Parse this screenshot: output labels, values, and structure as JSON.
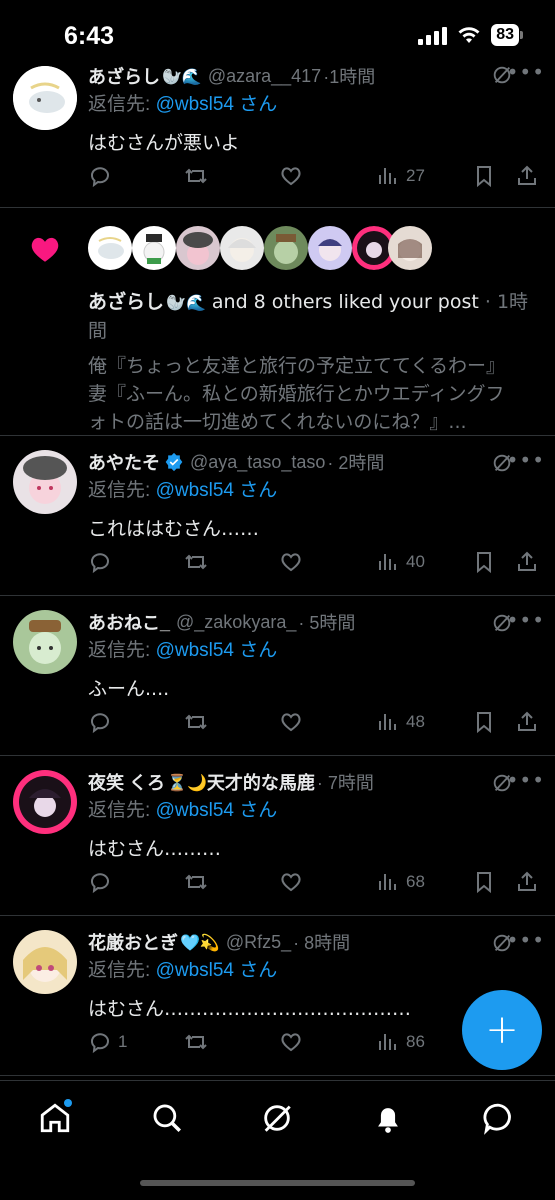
{
  "status": {
    "time": "6:43",
    "battery": "83"
  },
  "replies": [
    {
      "name": "あざらし",
      "emojis": "🦭🌊",
      "handle": "@azara__417",
      "time": "·1時間",
      "reply_prefix": "返信先: ",
      "mention": "@wbsl54 さん",
      "text": "はむさんが悪いよ",
      "replies": "",
      "views": "27"
    }
  ],
  "liked": {
    "name": "あざらし",
    "emojis": "🦭🌊",
    "suffix": " and 8 others liked your post",
    "time": "· 1時間",
    "preview_line1": "俺『ちょっと友達と旅行の予定立ててくるわー』",
    "preview_line2": "妻『ふーん。私との新婚旅行とかウエディングフ",
    "preview_line3": "ォトの話は一切進めてくれないのにね？』..."
  },
  "replies2": [
    {
      "name": "あやたそ",
      "handle": "@aya_taso_taso",
      "time": "· 2時間",
      "reply_prefix": "返信先: ",
      "mention": "@wbsl54 さん",
      "text": "これははむさん……",
      "replies": "",
      "views": "40"
    },
    {
      "name": "あおねこ_",
      "handle": "@_zakokyara_",
      "time": "· 5時間",
      "reply_prefix": "返信先: ",
      "mention": "@wbsl54 さん",
      "text": "ふーん....",
      "replies": "",
      "views": "48"
    },
    {
      "name": "夜笑 くろ",
      "emojis": "⏳🌙",
      "name_suffix": "天才的な馬鹿",
      "time": "· 7時間",
      "reply_prefix": "返信先: ",
      "mention": "@wbsl54 さん",
      "text": "はむさん………",
      "replies": "",
      "views": "68"
    },
    {
      "name": "花厳おとぎ",
      "emojis": "🩵💫",
      "handle": "@Rfz5_",
      "time": "· 8時間",
      "reply_prefix": "返信先: ",
      "mention": "@wbsl54 さん",
      "text": "はむさん…………………………………",
      "replies": "1",
      "views": "86"
    }
  ],
  "fab": {
    "label": "+"
  },
  "colors": {
    "accent": "#1d9bf0",
    "like": "#f91880",
    "muted": "#71767b"
  }
}
